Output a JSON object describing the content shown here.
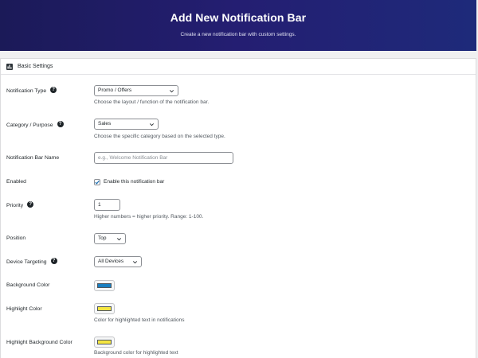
{
  "header": {
    "title": "Add New Notification Bar",
    "subtitle": "Create a new notification bar with custom settings."
  },
  "panel": {
    "title": "Basic Settings",
    "icon": "settings-panel-icon"
  },
  "fields": {
    "notification_type": {
      "label": "Notification Type",
      "value": "Promo / Offers",
      "description": "Choose the layout / function of the notification bar."
    },
    "category": {
      "label": "Category / Purpose",
      "value": "Sales",
      "description": "Choose the specific category based on the selected type."
    },
    "name": {
      "label": "Notification Bar Name",
      "value": "",
      "placeholder": "e.g., Welcome Notification Bar"
    },
    "enabled": {
      "label": "Enabled",
      "checked": true,
      "checkbox_label": "Enable this notification bar"
    },
    "priority": {
      "label": "Priority",
      "value": "1",
      "description": "Higher numbers = higher priority. Range: 1-100."
    },
    "position": {
      "label": "Position",
      "value": "Top"
    },
    "device_targeting": {
      "label": "Device Targeting",
      "value": "All Devices"
    },
    "background_color": {
      "label": "Background Color",
      "color": "#1a7fc1"
    },
    "highlight_color": {
      "label": "Highlight Color",
      "color": "#f5e642",
      "description": "Color for highlighted text in notifications"
    },
    "highlight_background_color": {
      "label": "Highlight Background Color",
      "color": "#f5e642",
      "description": "Background color for highlighted text"
    }
  },
  "colors": {
    "header_bg": "#1b1a58",
    "header_text": "#ffffff",
    "panel_bg": "#ffffff",
    "page_bg": "#f0f0f1",
    "accent": "#2271b1"
  }
}
